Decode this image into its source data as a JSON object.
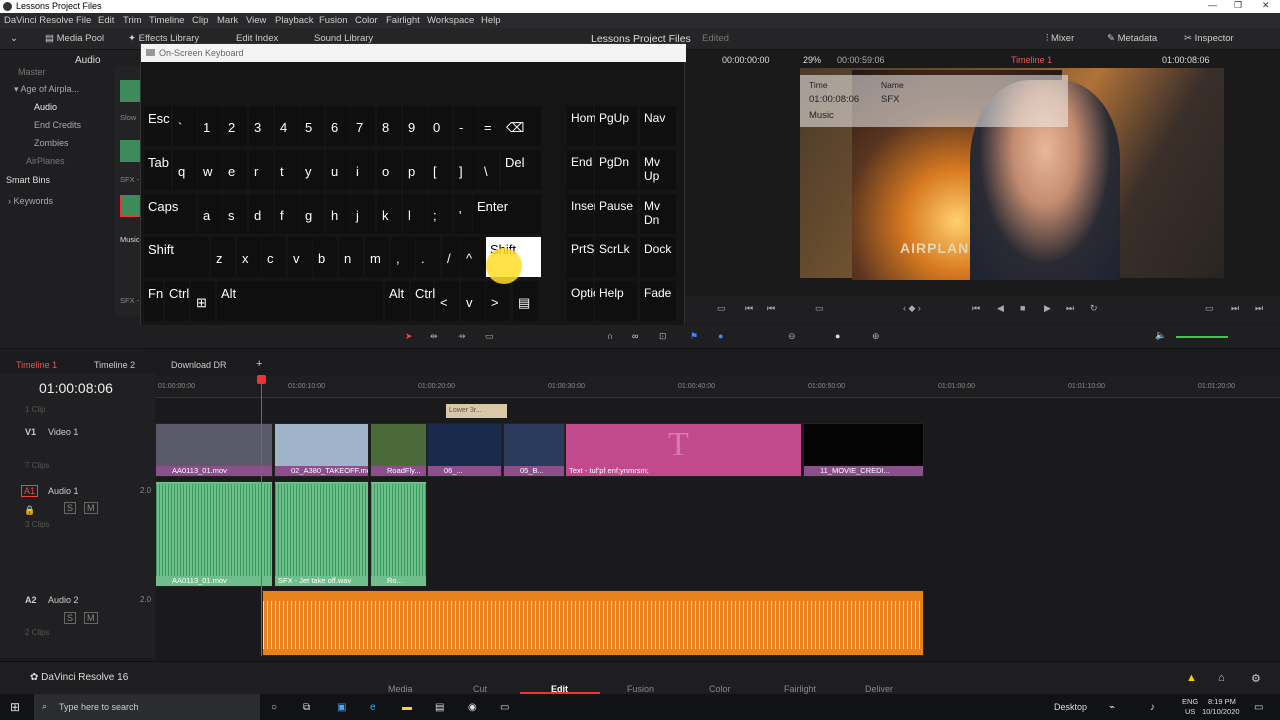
{
  "window": {
    "title": "Lessons Project Files",
    "minimize": "—",
    "maximize": "❐",
    "close": "✕"
  },
  "menu": [
    "DaVinci Resolve",
    "File",
    "Edit",
    "Trim",
    "Timeline",
    "Clip",
    "Mark",
    "View",
    "Playback",
    "Fusion",
    "Color",
    "Fairlight",
    "Workspace",
    "Help"
  ],
  "toolbar": {
    "media_pool": "Media Pool",
    "effects": "Effects Library",
    "edit_index": "Edit Index",
    "sound_library": "Sound Library",
    "project": "Lessons Project Files",
    "edited": "Edited",
    "mixer": "Mixer",
    "metadata": "Metadata",
    "inspector": "Inspector"
  },
  "left_panel": {
    "audio_tab": "Audio",
    "master": "Master",
    "bin_age": "Age of Airpla...",
    "bin_audio": "Audio",
    "bin_credits": "End Credits",
    "bin_zombies": "Zombies",
    "bin_airplanes": "AirPlanes",
    "smart_bins": "Smart Bins",
    "keywords": "Keywords",
    "thumb_slow": "Slow",
    "thumb_sfx": "SFX -",
    "thumb_music": "Music",
    "thumb_sfx2": "SFX -"
  },
  "keyboard": {
    "title": "On-Screen Keyboard",
    "rows": [
      [
        "Esc",
        "`",
        "1",
        "2",
        "3",
        "4",
        "5",
        "6",
        "7",
        "8",
        "9",
        "0",
        "-",
        "=",
        "⌫"
      ],
      [
        "Tab",
        "q",
        "w",
        "e",
        "r",
        "t",
        "y",
        "u",
        "i",
        "o",
        "p",
        "[",
        "]",
        "\\",
        "Del"
      ],
      [
        "Caps",
        "a",
        "s",
        "d",
        "f",
        "g",
        "h",
        "j",
        "k",
        "l",
        ";",
        "'",
        "Enter"
      ],
      [
        "Shift",
        "z",
        "x",
        "c",
        "v",
        "b",
        "n",
        "m",
        ",",
        ".",
        "/",
        "^",
        "Shift"
      ],
      [
        "Fn",
        "Ctrl",
        "⊞",
        "Alt",
        "Alt",
        "Ctrl",
        "<",
        "v",
        ">",
        "▤"
      ]
    ],
    "nav": [
      [
        "Home",
        "PgUp",
        "Nav"
      ],
      [
        "End",
        "PgDn",
        "Mv Up"
      ],
      [
        "Insert",
        "Pause",
        "Mv Dn"
      ],
      [
        "PrtScn",
        "ScrLk",
        "Dock"
      ],
      [
        "Options",
        "Help",
        "Fade"
      ]
    ]
  },
  "viewer": {
    "source_tc": "00:00:00:00",
    "zoom": "29%",
    "rec_tc": "00:00:59:06",
    "timeline_name": "Timeline 1",
    "tc": "01:00:08:06",
    "meta_time_label": "Time",
    "meta_time": "01:00:08:06",
    "meta_name_label": "Name",
    "meta_name": "SFX",
    "meta_music": "Music",
    "poster_text": "AIRPLANES"
  },
  "timeline": {
    "tabs": [
      "Timeline 1",
      "Timeline 2",
      "Download DR"
    ],
    "timecode": "01:00:08:06",
    "ruler": [
      "01:00:00:00",
      "01:00:10:00",
      "01:00:20:00",
      "01:00:30:00",
      "01:00:40:00",
      "01:00:50:00",
      "01:01:00:00",
      "01:01:10:00",
      "01:01:20:00"
    ],
    "tracks": [
      {
        "id": "V1",
        "name": "Video 1",
        "sub": "7 Clips"
      },
      {
        "id": "A1",
        "name": "Audio 1",
        "level": "2.0",
        "sub": "3 Clips"
      },
      {
        "id": "A2",
        "name": "Audio 2",
        "level": "2.0",
        "sub": "2 Clips"
      }
    ],
    "top_sub": "1 Clip",
    "lower_third": "Lower 3r...",
    "video_clips": [
      "AA0113_01.mov",
      "02_A380_TAKEOFF.mov",
      "RoadFly...",
      "06_...",
      "05_B...",
      "Text - tuf'pf enf;ynmrsm;",
      "11_MOVIE_CREDI..."
    ],
    "credits_text": "· \u0000",
    "audio1_clips": [
      "AA0113_01.mov",
      "SFX - Jet take off.wav",
      "Ro..."
    ]
  },
  "pages": [
    "Media",
    "Cut",
    "Edit",
    "Fusion",
    "Color",
    "Fairlight",
    "Deliver"
  ],
  "app_name": "DaVinci Resolve 16",
  "taskbar": {
    "search": "Type here to search",
    "desktop": "Desktop",
    "lang": "ENG",
    "region": "US",
    "time": "8:19 PM",
    "date": "10/10/2020"
  }
}
